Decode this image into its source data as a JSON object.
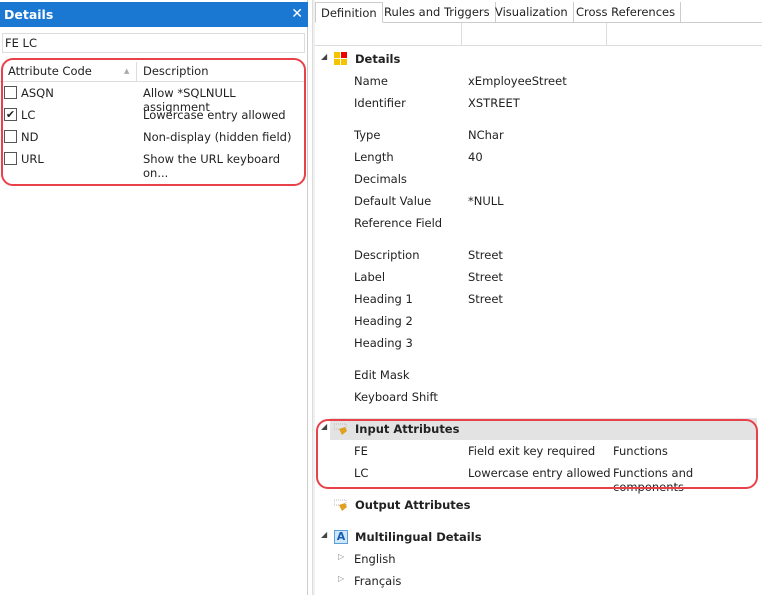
{
  "left": {
    "title": "Details",
    "search_value": "FE LC",
    "columns": [
      "Attribute Code",
      "Description"
    ],
    "rows": [
      {
        "code": "ASQN",
        "desc": "Allow *SQLNULL assignment",
        "checked": false
      },
      {
        "code": "LC",
        "desc": "Lowercase entry allowed",
        "checked": true
      },
      {
        "code": "ND",
        "desc": "Non-display (hidden field)",
        "checked": false
      },
      {
        "code": "URL",
        "desc": "Show the URL keyboard on...",
        "checked": false
      }
    ]
  },
  "tabs": [
    "Definition",
    "Rules and Triggers",
    "Visualization",
    "Cross References"
  ],
  "details": {
    "title": "Details",
    "name_l": "Name",
    "name_v": "xEmployeeStreet",
    "id_l": "Identifier",
    "id_v": "XSTREET",
    "type_l": "Type",
    "type_v": "NChar",
    "len_l": "Length",
    "len_v": "40",
    "dec_l": "Decimals",
    "def_l": "Default Value",
    "def_v": "*NULL",
    "ref_l": "Reference Field",
    "desc_l": "Description",
    "desc_v": "Street",
    "label_l": "Label",
    "label_v": "Street",
    "h1_l": "Heading 1",
    "h1_v": "Street",
    "h2_l": "Heading 2",
    "h3_l": "Heading 3",
    "mask_l": "Edit Mask",
    "shift_l": "Keyboard Shift"
  },
  "input": {
    "title": "Input Attributes",
    "rows": [
      {
        "code": "FE",
        "desc": "Field exit key required",
        "scope": "Functions"
      },
      {
        "code": "LC",
        "desc": "Lowercase entry allowed",
        "scope": "Functions and components"
      }
    ]
  },
  "output": {
    "title": "Output Attributes"
  },
  "multi": {
    "title": "Multilingual Details",
    "langs": [
      "English",
      "Français"
    ]
  },
  "colors": {
    "titlebar": "#1a78d2",
    "highlight": "#e8414a"
  }
}
